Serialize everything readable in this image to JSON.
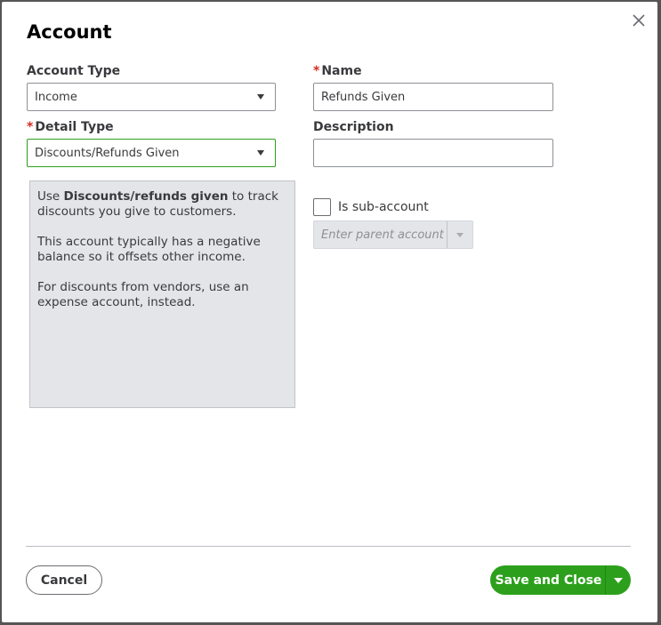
{
  "dialog": {
    "title": "Account",
    "account_type": {
      "label": "Account Type",
      "value": "Income"
    },
    "name": {
      "required_mark": "*",
      "label": "Name",
      "value": "Refunds Given"
    },
    "detail_type": {
      "required_mark": "*",
      "label": "Detail Type",
      "value": "Discounts/Refunds Given"
    },
    "description": {
      "label": "Description",
      "value": ""
    },
    "info": {
      "p1_prefix": "Use ",
      "p1_bold": "Discounts/refunds given",
      "p1_suffix": " to track discounts you give to customers.",
      "p2": "This account typically has a negative balance so it offsets other income.",
      "p3": "For discounts from vendors, use an expense account, instead."
    },
    "sub_account": {
      "label": "Is sub-account",
      "checked": false
    },
    "parent_account": {
      "placeholder": "Enter parent account"
    },
    "buttons": {
      "cancel": "Cancel",
      "save": "Save and Close"
    }
  },
  "colors": {
    "primary": "#2ca01c",
    "required": "#d52b1e"
  }
}
